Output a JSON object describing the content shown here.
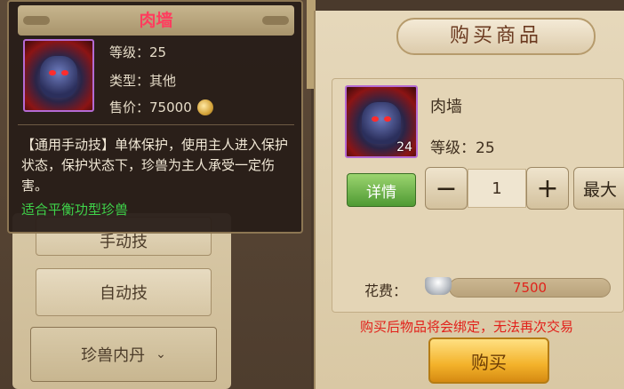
{
  "tooltip": {
    "title": "肉墙",
    "level_label": "等级：",
    "level_value": "25",
    "type_label": "类型：",
    "type_value": "其他",
    "price_label": "售价：",
    "price_value": "75000",
    "price_icon": "coin-icon",
    "description": "【通用手动技】单体保护，使用主人进入保护状态，保护状态下，珍兽为主人承受一定伤害。",
    "tip": "适合平衡功型珍兽",
    "tip_color": "#3fd34a",
    "title_color": "#ff3d5e"
  },
  "background_panel": {
    "buttons": [
      "手动技",
      "自动技",
      "珍兽内丹"
    ]
  },
  "purchase": {
    "title": "购买商品",
    "item_name": "肉墙",
    "item_count": "24",
    "level_label": "等级：",
    "level_value": "25",
    "detail_label": "详情",
    "minus_label": "−",
    "quantity": "1",
    "plus_label": "+",
    "max_label": "最大",
    "cost_label": "花费：",
    "cost_icon": "silver-ingot-icon",
    "cost_value": "7500",
    "warning": "购买后物品将会绑定，无法再次交易",
    "buy_label": "购买",
    "warning_color": "#e2201a"
  }
}
